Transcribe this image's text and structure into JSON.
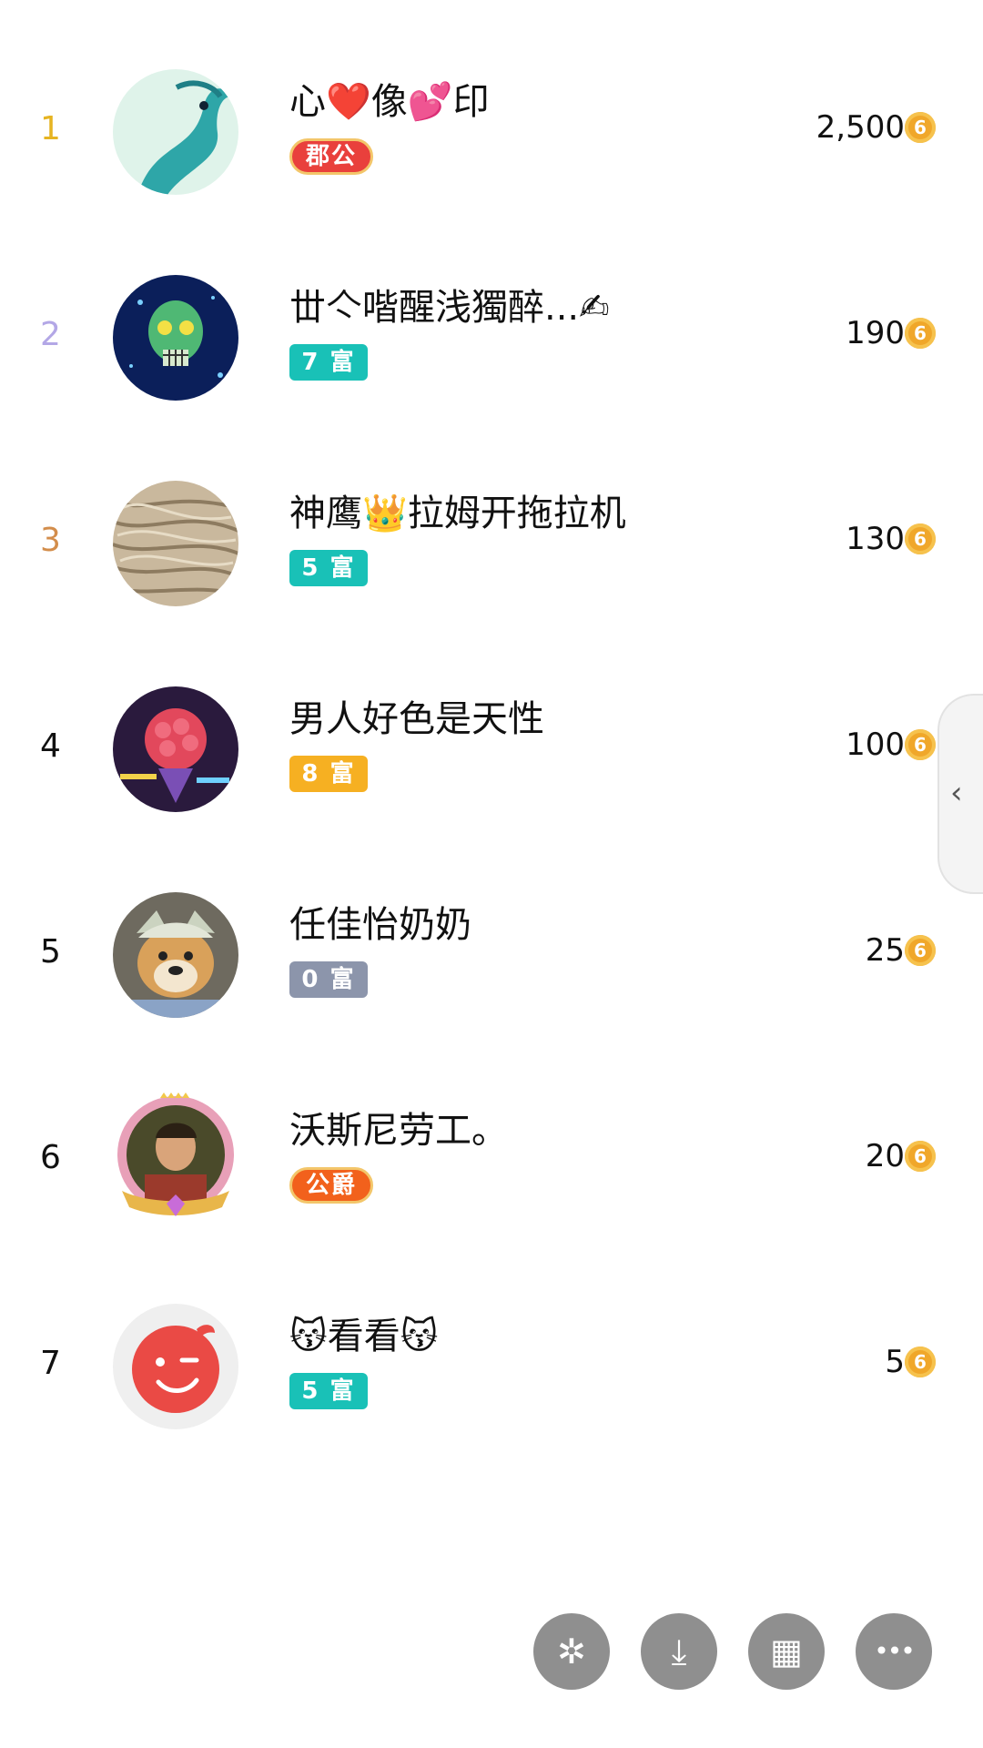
{
  "leaderboard": [
    {
      "rank": "1",
      "name": "心❤️像💕印",
      "badge": "郡公",
      "score": "2,500",
      "rank_color": "#e6b422",
      "badge_color": "#e9403c",
      "badge_style": "wide"
    },
    {
      "rank": "2",
      "name": "丗亽喈醒浅獨醉...✍",
      "badge": "7 富",
      "score": "190",
      "rank_color": "#b3a7e6",
      "badge_color": "#19c1b7",
      "badge_style": "plain"
    },
    {
      "rank": "3",
      "name": "神鹰👑拉姆开拖拉机",
      "badge": "5 富",
      "score": "130",
      "rank_color": "#d38d4b",
      "badge_color": "#19c1b7",
      "badge_style": "plain"
    },
    {
      "rank": "4",
      "name": "男人好色是天性",
      "badge": "8 富",
      "score": "100",
      "rank_color": "#111111",
      "badge_color": "#f6b022",
      "badge_style": "plain"
    },
    {
      "rank": "5",
      "name": "任佳怡奶奶",
      "badge": "0 富",
      "score": "25",
      "rank_color": "#111111",
      "badge_color": "#8c95ab",
      "badge_style": "plain"
    },
    {
      "rank": "6",
      "name": "沃斯尼劳工。",
      "badge": "公爵",
      "score": "20",
      "rank_color": "#111111",
      "badge_color": "#f2611c",
      "badge_style": "wide"
    },
    {
      "rank": "7",
      "name": "😽看看😽",
      "badge": "5 富",
      "score": "5",
      "rank_color": "#111111",
      "badge_color": "#19c1b7",
      "badge_style": "plain"
    }
  ],
  "coin_symbol": "6",
  "side_tab": {
    "icon": "chevron-left-icon",
    "glyph": "‹"
  },
  "action_buttons": [
    {
      "icon": "share-icon",
      "glyph": "✲"
    },
    {
      "icon": "download-icon",
      "glyph": "⤓"
    },
    {
      "icon": "apps-grid-icon",
      "glyph": "▦"
    },
    {
      "icon": "more-icon",
      "glyph": "•••"
    }
  ]
}
